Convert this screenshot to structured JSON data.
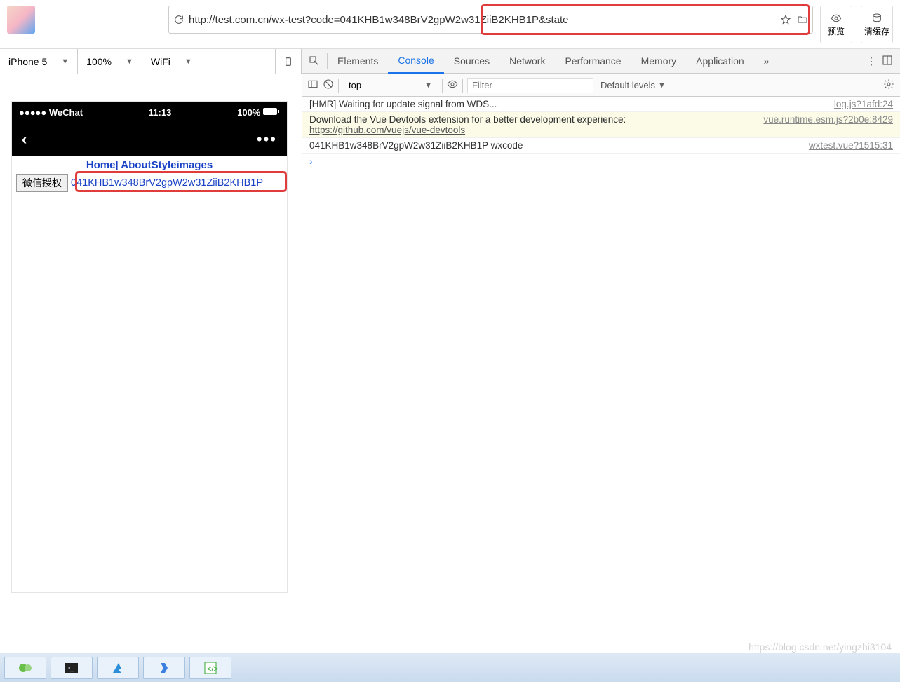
{
  "browser": {
    "url": "http://test.com.cn/wx-test?code=041KHB1w348BrV2gpW2w31ZiiB2KHB1P&state",
    "preview_label": "预览",
    "clear_cache_label": "清缓存"
  },
  "device_bar": {
    "device": "iPhone 5",
    "zoom": "100%",
    "network": "WiFi"
  },
  "devtools": {
    "tabs": [
      "Elements",
      "Console",
      "Sources",
      "Network",
      "Performance",
      "Memory",
      "Application"
    ],
    "active_tab": "Console",
    "context": "top",
    "filter_placeholder": "Filter",
    "levels": "Default levels"
  },
  "console": {
    "rows": [
      {
        "msg": "[HMR] Waiting for update signal from WDS...",
        "link": "log.js?1afd:24"
      },
      {
        "msg_line1": "Download the Vue Devtools extension for a better development experience:",
        "url": "https://github.com/vuejs/vue-devtools",
        "link": "vue.runtime.esm.js?2b0e:8429"
      },
      {
        "msg": "041KHB1w348BrV2gpW2w31ZiiB2KHB1P wxcode",
        "link": "wxtest.vue?1515:31"
      }
    ]
  },
  "phone": {
    "carrier": "●●●●● WeChat",
    "time": "11:13",
    "battery": "100%",
    "nav_links": "Home| AboutStyleimages",
    "wx_btn": "微信授权",
    "wx_code": "041KHB1w348BrV2gpW2w31ZiiB2KHB1P"
  },
  "watermark": "https://blog.csdn.net/yingzhi3104"
}
